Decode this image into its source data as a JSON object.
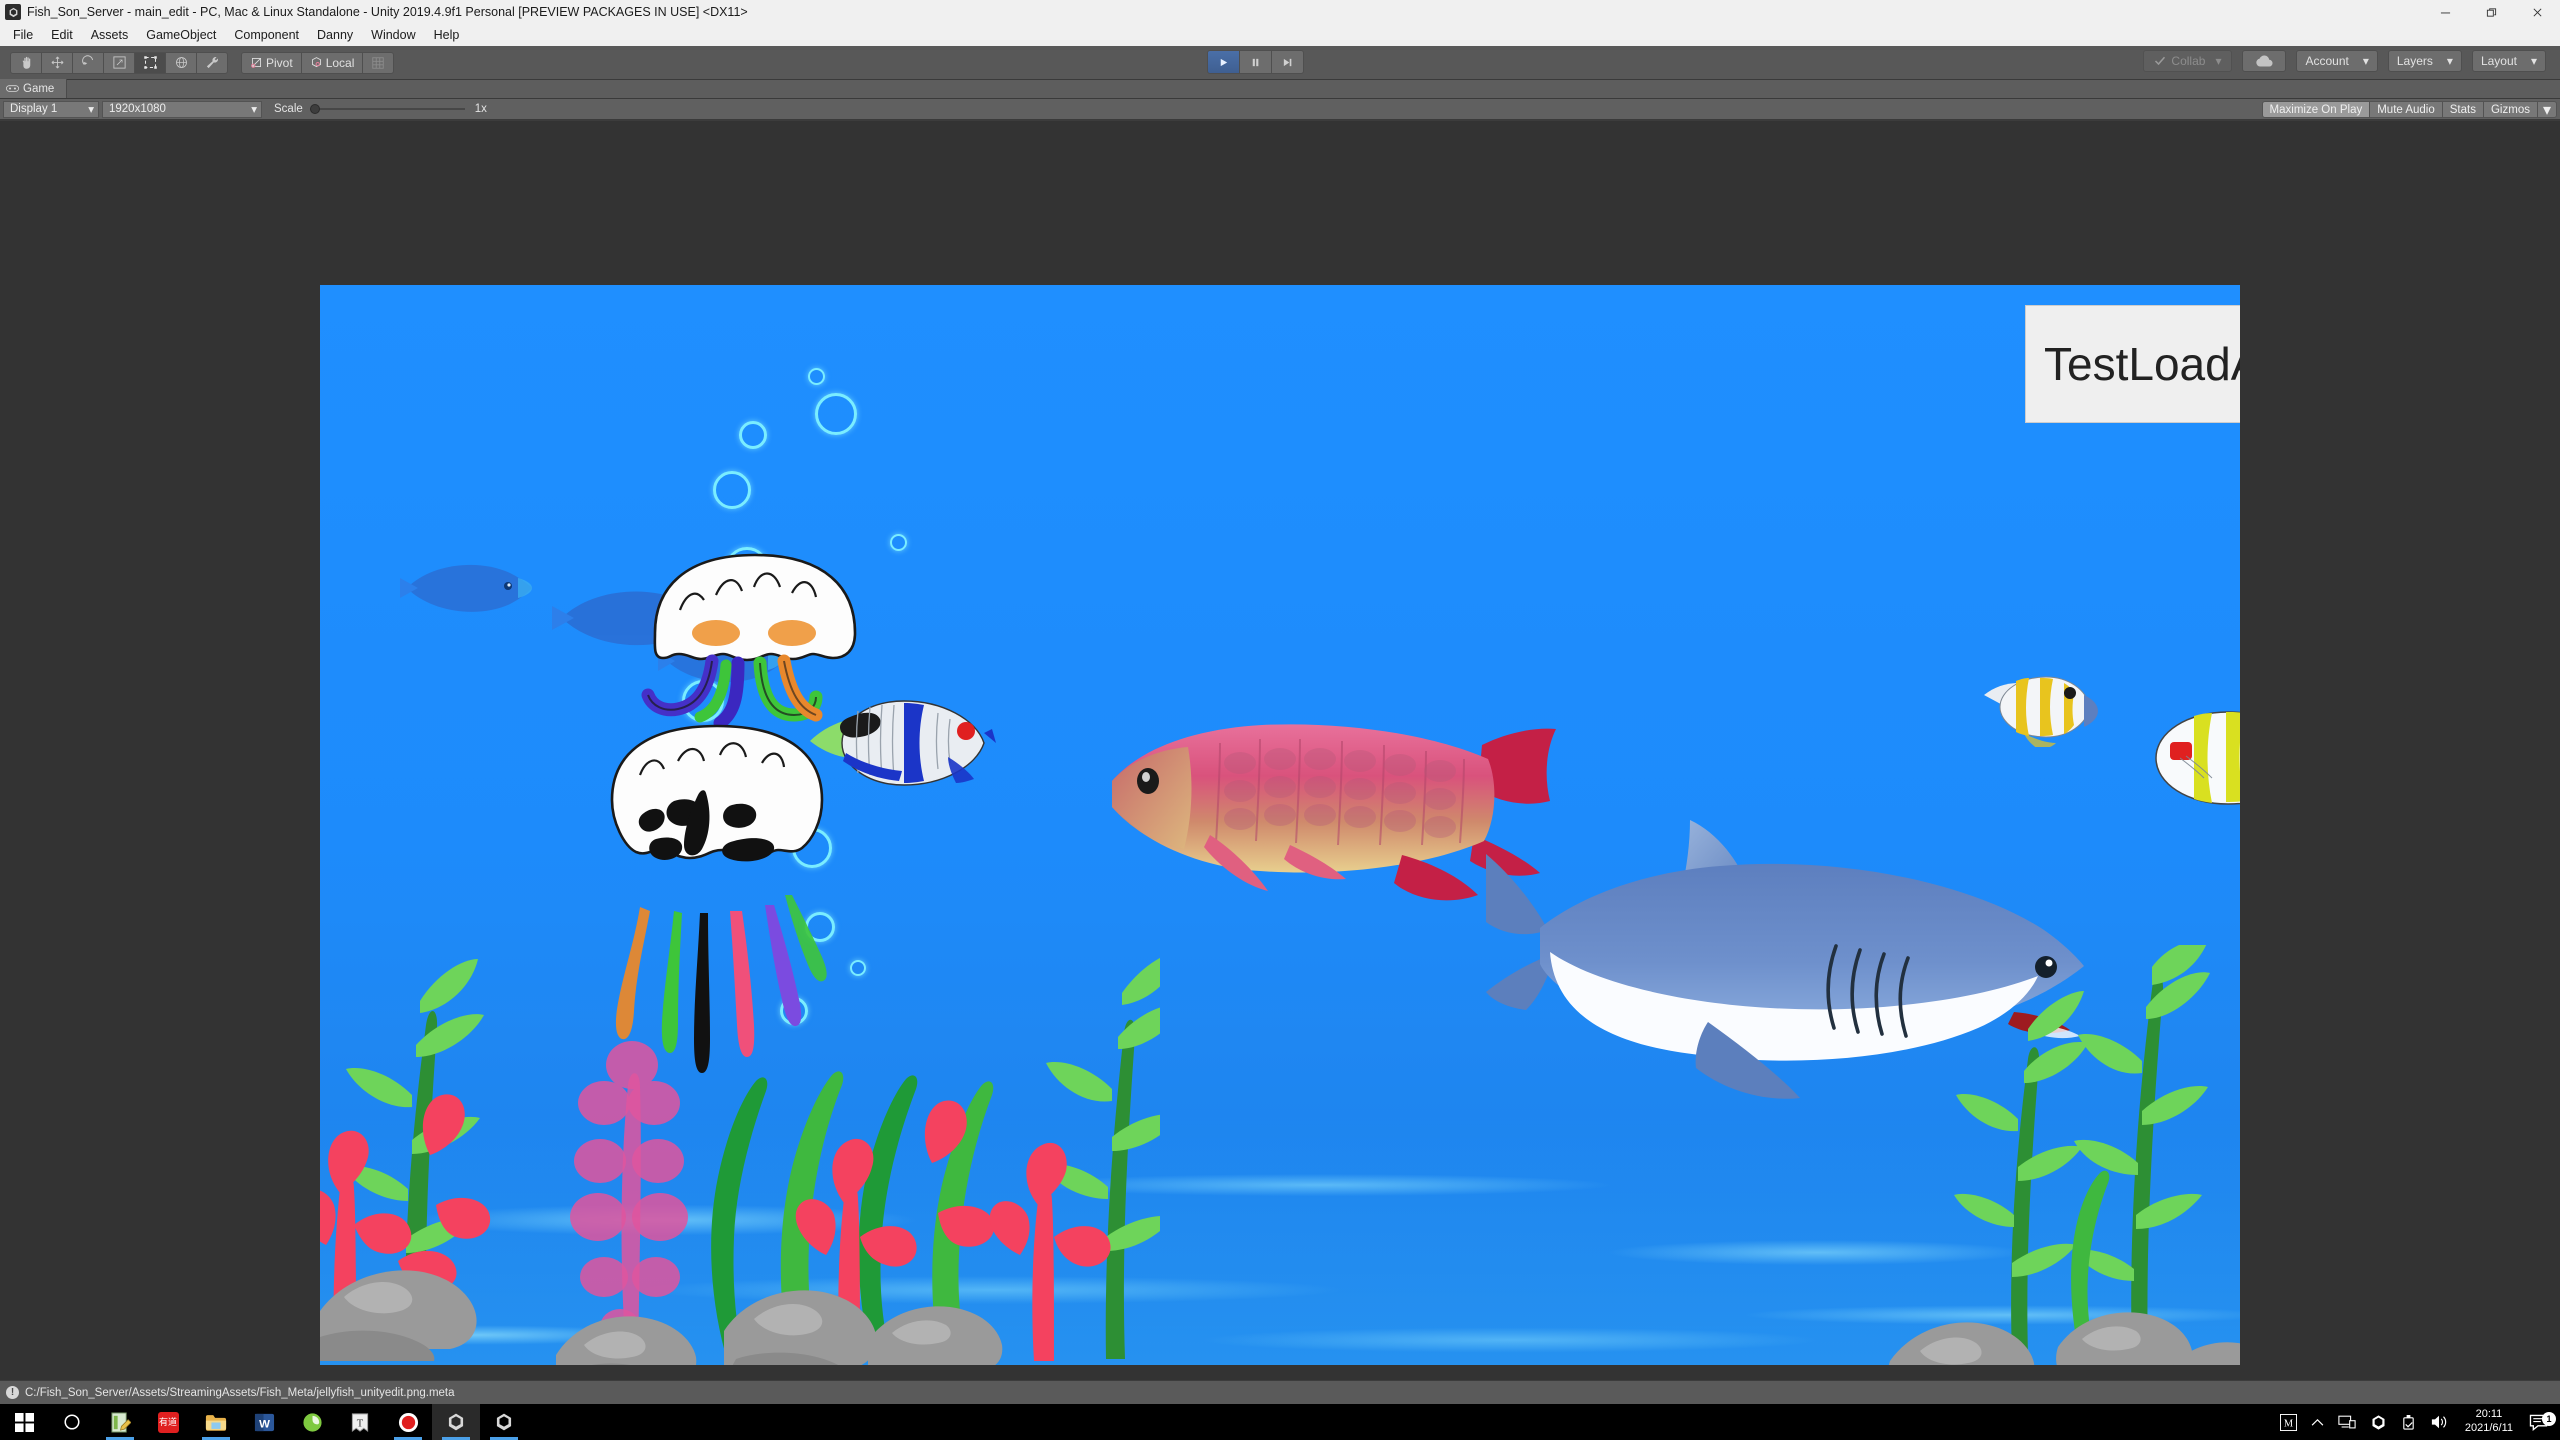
{
  "window": {
    "title": "Fish_Son_Server - main_edit - PC, Mac & Linux Standalone - Unity 2019.4.9f1 Personal [PREVIEW PACKAGES IN USE] <DX11>",
    "app_icon": "unity-icon",
    "minimize_label": "—",
    "restore_label": "❐",
    "close_label": "✕"
  },
  "menubar": {
    "items": [
      {
        "label": "File"
      },
      {
        "label": "Edit"
      },
      {
        "label": "Assets"
      },
      {
        "label": "GameObject"
      },
      {
        "label": "Component"
      },
      {
        "label": "Danny"
      },
      {
        "label": "Window"
      },
      {
        "label": "Help"
      }
    ]
  },
  "toolbar": {
    "tools": [
      {
        "name": "hand-tool",
        "icon": "hand-icon",
        "active": false
      },
      {
        "name": "move-tool",
        "icon": "move-icon",
        "active": false
      },
      {
        "name": "rotate-tool",
        "icon": "rotate-icon",
        "active": false
      },
      {
        "name": "scale-tool",
        "icon": "scale-icon",
        "active": false
      },
      {
        "name": "rect-tool",
        "icon": "rect-transform-icon",
        "active": true
      },
      {
        "name": "transform-tool",
        "icon": "transform-icon",
        "active": false
      },
      {
        "name": "custom-tool",
        "icon": "wrench-icon",
        "active": false
      }
    ],
    "pivot_label": "Pivot",
    "local_label": "Local",
    "play_label": "▶",
    "pause_label": "‖",
    "step_label": "▶|",
    "collab_label": "Collab",
    "cloud_label": "cloud-icon",
    "account_label": "Account",
    "layers_label": "Layers",
    "layout_label": "Layout",
    "caret": "▾"
  },
  "game_panel": {
    "tab_label": "Game",
    "tab_icon": "game-view-icon",
    "display_value": "Display 1",
    "resolution_value": "1920x1080",
    "scale_label": "Scale",
    "scale_value": "1x",
    "scale_percent": 0,
    "maximize_label": "Maximize On Play",
    "mute_label": "Mute Audio",
    "stats_label": "Stats",
    "gizmos_label": "Gizmos",
    "caret": "▾"
  },
  "game_scene": {
    "ui_overlay_text": "TestLoadASp",
    "background_color": "#1E90FF",
    "objects": [
      {
        "name": "jellyfish-white-orange",
        "label": "Jellyfish (orange spots)"
      },
      {
        "name": "jellyfish-black-marked",
        "label": "Jellyfish (black marks)"
      },
      {
        "name": "blue-fish-school",
        "label": "Blue fish school"
      },
      {
        "name": "angelfish-striped",
        "label": "Striped angelfish"
      },
      {
        "name": "arowana-red",
        "label": "Red arowana"
      },
      {
        "name": "shark-blue",
        "label": "Blue shark"
      },
      {
        "name": "butterflyfish-small",
        "label": "Small butterflyfish"
      },
      {
        "name": "butterflyfish-yellow",
        "label": "Yellow butterflyfish"
      },
      {
        "name": "seaweed-left",
        "label": "Seaweed cluster left"
      },
      {
        "name": "seaweed-right",
        "label": "Seaweed cluster right"
      },
      {
        "name": "coral-red",
        "label": "Red coral"
      },
      {
        "name": "rocks",
        "label": "Rocks"
      }
    ]
  },
  "statusbar": {
    "icon": "warning-icon",
    "message": "C:/Fish_Son_Server/Assets/StreamingAssets/Fish_Meta/jellyfish_unityedit.png.meta"
  },
  "taskbar": {
    "items": [
      {
        "name": "start-button",
        "icon": "windows-logo"
      },
      {
        "name": "search-button",
        "icon": "search-circle-icon"
      },
      {
        "name": "notepad-app",
        "icon": "notepad-icon"
      },
      {
        "name": "youdao-app",
        "icon": "youdao-icon",
        "text": "有道"
      },
      {
        "name": "file-explorer-app",
        "icon": "folder-icon"
      },
      {
        "name": "word-app",
        "icon": "word-icon",
        "text": "W"
      },
      {
        "name": "browser-app",
        "icon": "browser-icon"
      },
      {
        "name": "typora-app",
        "icon": "typora-icon",
        "text": "T"
      },
      {
        "name": "recorder-app",
        "icon": "record-icon"
      },
      {
        "name": "unity-app-1",
        "icon": "unity-icon"
      },
      {
        "name": "unity-app-2",
        "icon": "unity-icon"
      }
    ],
    "tray": {
      "m_icon": "m-icon",
      "chevron": "∧",
      "network_icon": "network-icon",
      "unity_tray_icon": "unity-icon",
      "usb_icon": "usb-icon",
      "volume_icon": "volume-icon",
      "time": "20:11",
      "date": "2021/6/11",
      "notification_icon": "notification-icon",
      "notification_count": "1"
    }
  }
}
